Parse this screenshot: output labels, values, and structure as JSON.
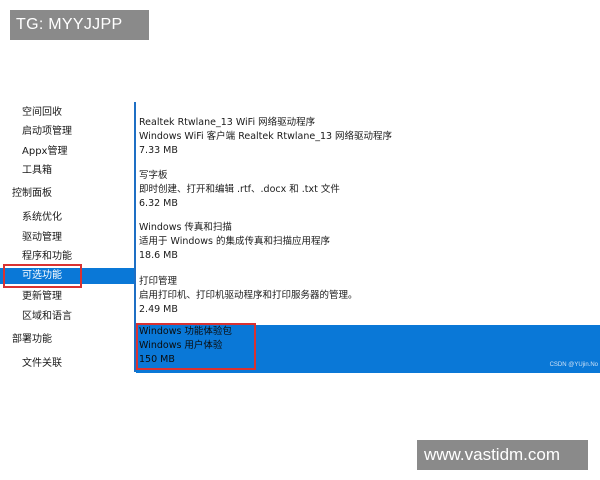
{
  "watermarks": {
    "top": "TG: MYYJJPP",
    "bottom": "www.vastidm.com",
    "csdn": "CSDN @YUjin.No"
  },
  "sidebar": {
    "items": [
      {
        "label": "空间回收",
        "kind": "sub"
      },
      {
        "label": "启动项管理",
        "kind": "sub"
      },
      {
        "label": "Appx管理",
        "kind": "sub"
      },
      {
        "label": "工具箱",
        "kind": "sub"
      },
      {
        "label": "控制面板",
        "kind": "category"
      },
      {
        "label": "系统优化",
        "kind": "sub"
      },
      {
        "label": "驱动管理",
        "kind": "sub"
      },
      {
        "label": "程序和功能",
        "kind": "sub"
      },
      {
        "label": "可选功能",
        "kind": "sub",
        "selected": true
      },
      {
        "label": "更新管理",
        "kind": "sub"
      },
      {
        "label": "区域和语言",
        "kind": "sub"
      },
      {
        "label": "部署功能",
        "kind": "category"
      },
      {
        "label": "文件关联",
        "kind": "sub"
      }
    ]
  },
  "features": [
    {
      "name": "Realtek Rtwlane_13 WiFi 网络驱动程序",
      "description": "Windows WiFi 客户端 Realtek Rtwlane_13 网络驱动程序",
      "size": "7.33 MB"
    },
    {
      "name": "写字板",
      "description": "即时创建、打开和编辑 .rtf、.docx 和 .txt 文件",
      "size": "6.32 MB"
    },
    {
      "name": "Windows 传真和扫描",
      "description": "适用于 Windows 的集成传真和扫描应用程序",
      "size": "18.6 MB"
    },
    {
      "name": "打印管理",
      "description": "启用打印机、打印机驱动程序和打印服务器的管理。",
      "size": "2.49 MB"
    },
    {
      "name": "Windows 功能体验包",
      "description": "Windows 用户体验",
      "size": "150 MB",
      "selected": true
    }
  ],
  "colors": {
    "selection": "#0a78d7",
    "divider": "#1e6fc4",
    "highlight_border": "#d93232",
    "watermark_bg": "#8a8a8a"
  }
}
